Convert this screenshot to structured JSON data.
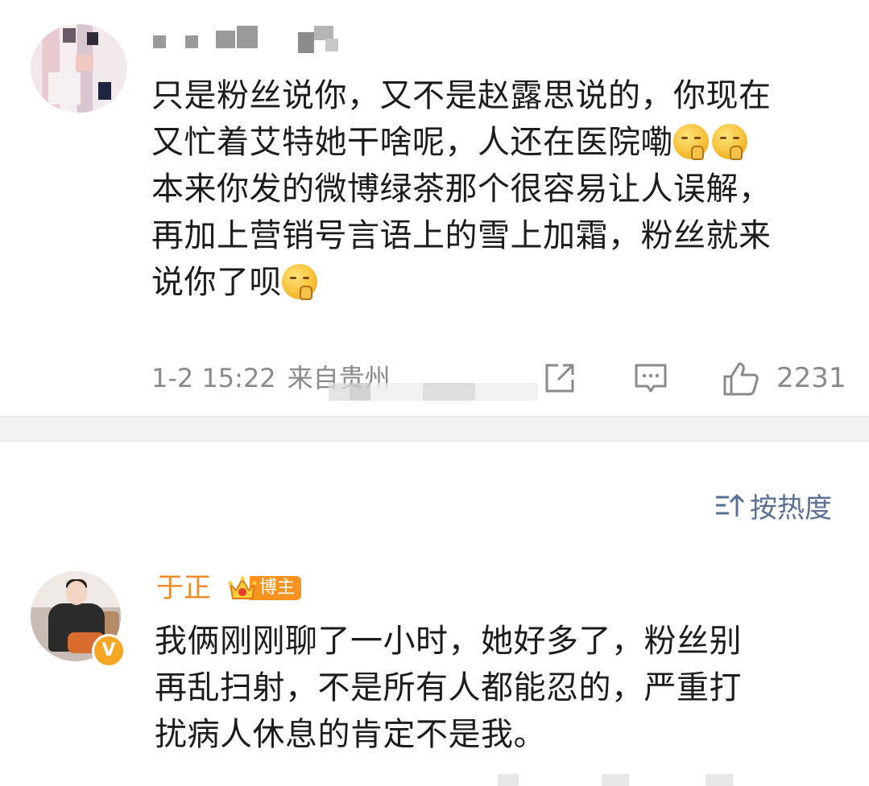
{
  "comment1": {
    "lines": [
      "只是粉丝说你，又不是赵露思说的，你现在",
      "又忙着艾特她干啥呢，人还在医院嘞",
      "本来你发的微博绿茶那个很容易让人误解，",
      "再加上营销号言语上的雪上加霜，粉丝就来",
      "说你了呗"
    ],
    "time": "1-2 15:22",
    "location": "来自贵州",
    "like_count": "2231",
    "emoji_name": "shush-face-emoji"
  },
  "sort": {
    "label": "按热度"
  },
  "reply": {
    "username": "于正",
    "role": "博主",
    "verified_mark": "V",
    "lines": [
      "我俩刚刚聊了一小时，她好多了，粉丝别",
      "再乱扫射，不是所有人都能忍的，严重打",
      "扰病人休息的肯定不是我。"
    ]
  },
  "colors": {
    "text": "#1c1c1c",
    "meta": "#8a8a8a",
    "sort_link": "#5b6f94",
    "username_orange": "#f08b2c",
    "role_tag": "#f7931e"
  }
}
